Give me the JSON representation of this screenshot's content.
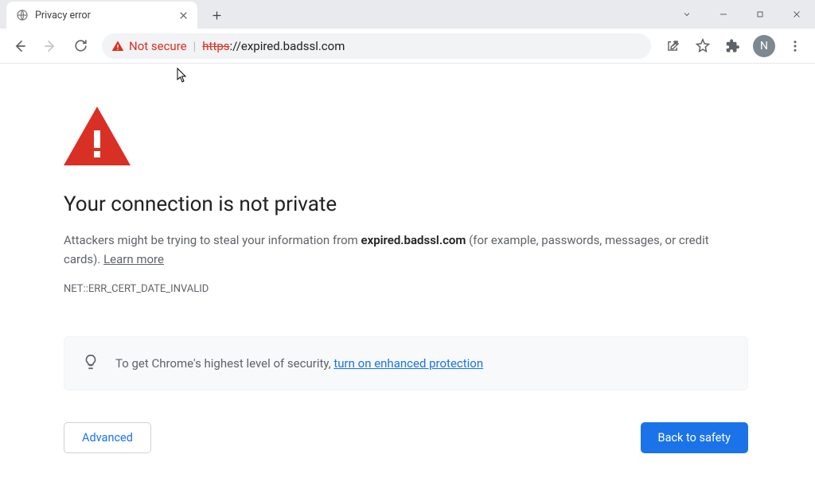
{
  "tab": {
    "title": "Privacy error"
  },
  "omnibox": {
    "not_secure": "Not secure",
    "url_https": "https",
    "url_rest": "://expired.badssl.com"
  },
  "avatar": {
    "letter": "N"
  },
  "page": {
    "headline": "Your connection is not private",
    "body_pre": "Attackers might be trying to steal your information from ",
    "body_domain": "expired.badssl.com",
    "body_post": " (for example, passwords, messages, or credit cards). ",
    "learn_more": "Learn more",
    "error_code": "NET::ERR_CERT_DATE_INVALID",
    "tip_pre": "To get Chrome's highest level of security, ",
    "tip_link": "turn on enhanced protection",
    "advanced": "Advanced",
    "back_to_safety": "Back to safety"
  }
}
